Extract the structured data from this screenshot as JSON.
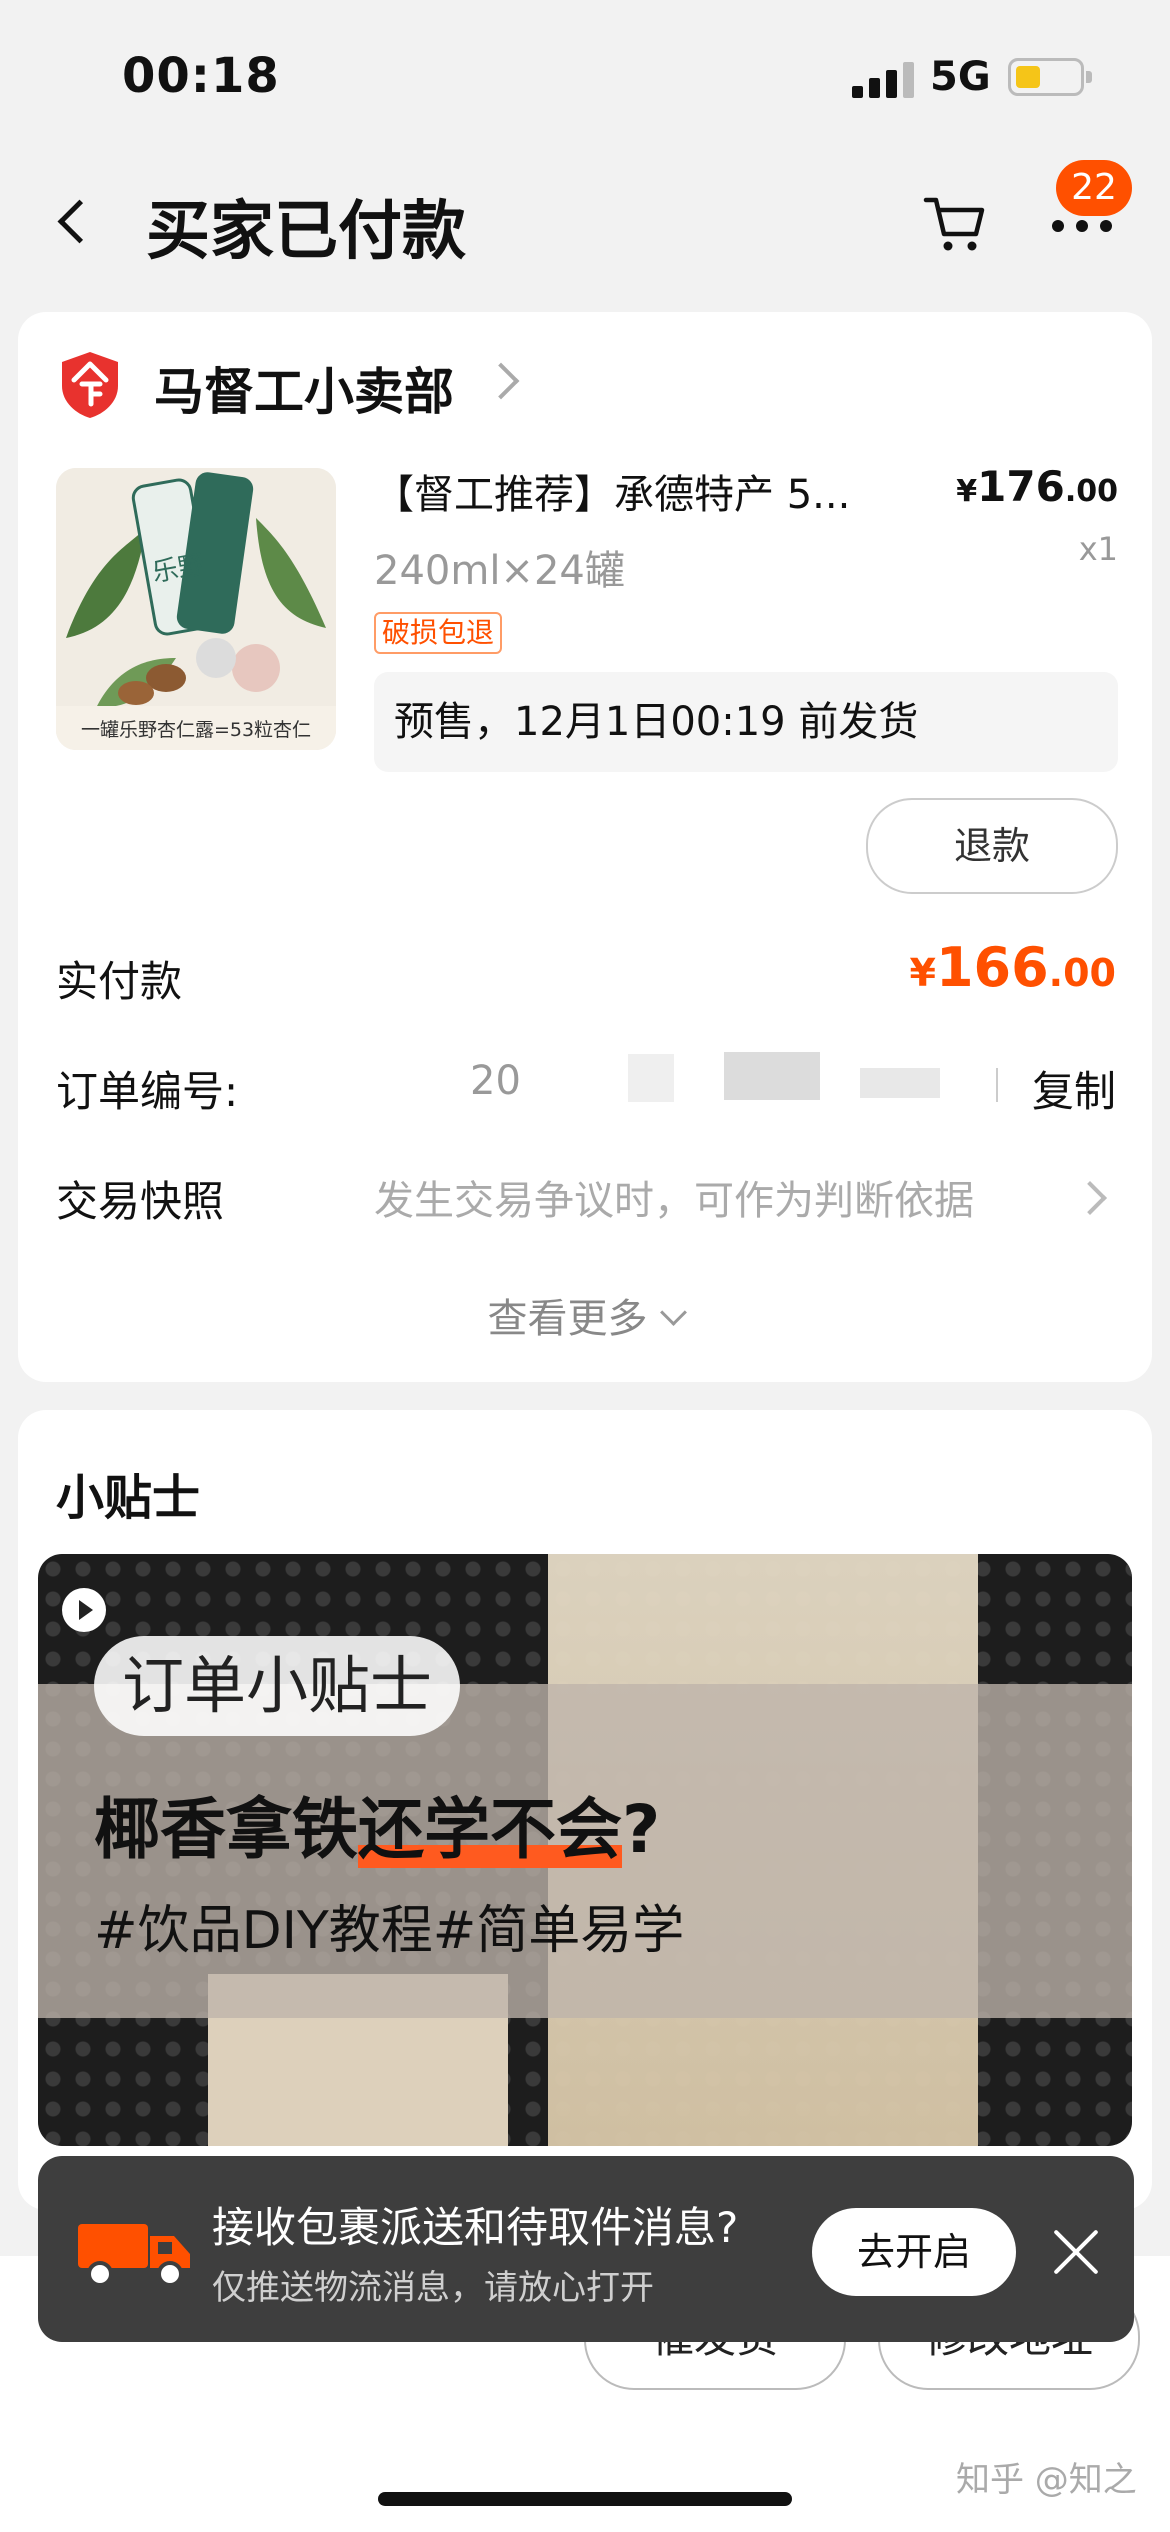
{
  "status": {
    "time": "00:18",
    "network": "5G"
  },
  "nav": {
    "title": "买家已付款",
    "badge": "22"
  },
  "shop": {
    "name": "马督工小卖部"
  },
  "product": {
    "title": "【督工推荐】承德特产 5...",
    "spec": "240ml×24罐",
    "tag": "破损包退",
    "price_currency": "¥",
    "price_int": "176",
    "price_dec": ".00",
    "qty": "x1",
    "notice": "预售，12月1日00:19 前发货",
    "refund_label": "退款",
    "image_caption": "一罐乐野杏仁露=53粒杏仁",
    "image_brand": "乐野"
  },
  "payment": {
    "label": "实付款",
    "currency": "¥",
    "int": "166",
    "dec": ".00"
  },
  "order": {
    "number_label": "订单编号:",
    "number_visible": "20",
    "copy_label": "复制",
    "snapshot_label": "交易快照",
    "snapshot_desc": "发生交易争议时，可作为判断依据",
    "more_label": "查看更多"
  },
  "tips": {
    "title": "小贴士",
    "video_pill": "订单小贴士",
    "video_head_a": "椰香拿铁",
    "video_head_b": "还学不会",
    "video_head_c": "?",
    "video_sub": "#饮品DIY教程#简单易学"
  },
  "toast": {
    "title": "接收包裹派送和待取件消息?",
    "subtitle": "仅推送物流消息，请放心打开",
    "button": "去开启"
  },
  "bottom": {
    "urge_label": "催发货",
    "address_label": "修改地址",
    "watermark": "知乎 @知之"
  },
  "colors": {
    "accent": "#ff5000",
    "toast_bg": "#3e3e3e"
  },
  "icons": [
    "back-icon",
    "cart-icon",
    "more-icon",
    "shop-badge-icon",
    "chevron-right-icon",
    "chevron-down-icon",
    "play-icon",
    "truck-icon",
    "close-icon"
  ]
}
